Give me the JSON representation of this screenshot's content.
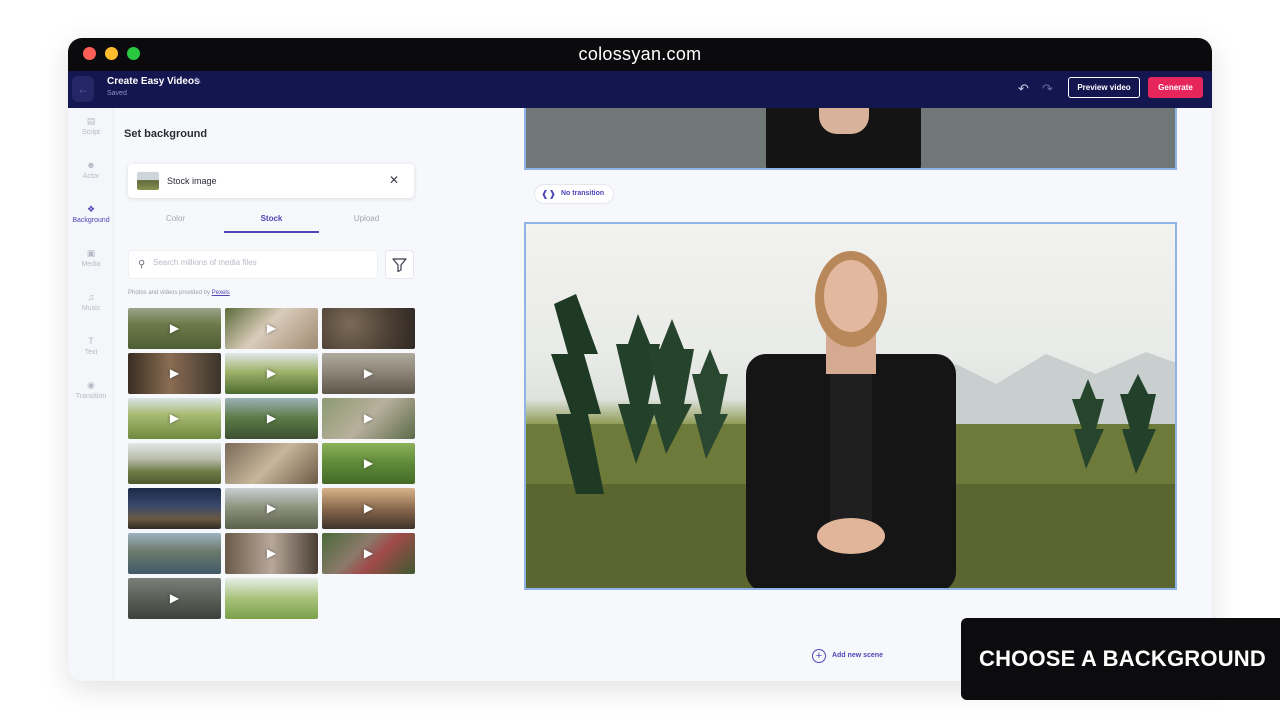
{
  "window": {
    "url": "colossyan.com"
  },
  "header": {
    "project_title": "Create Easy Videos",
    "status": "Saved",
    "preview_label": "Preview video",
    "generate_label": "Generate"
  },
  "rail": {
    "items": [
      {
        "label": "Script",
        "icon": "script-icon"
      },
      {
        "label": "Actor",
        "icon": "actor-icon"
      },
      {
        "label": "Background",
        "icon": "background-icon",
        "active": true
      },
      {
        "label": "Media",
        "icon": "media-icon"
      },
      {
        "label": "Music",
        "icon": "music-icon"
      },
      {
        "label": "Text",
        "icon": "text-icon"
      },
      {
        "label": "Transition",
        "icon": "transition-icon"
      }
    ]
  },
  "panel": {
    "title": "Set background",
    "selected": {
      "label": "Stock image"
    },
    "tabs": [
      "Color",
      "Stock",
      "Upload"
    ],
    "active_tab": "Stock",
    "search": {
      "placeholder": "Search millions of media files",
      "value": ""
    },
    "credit_prefix": "Photos and videos provided by",
    "credit_link": "Pexels"
  },
  "canvas": {
    "transition_label": "No transition",
    "add_scene_label": "Add new scene"
  },
  "overlay": {
    "caption": "CHOOSE A BACKGROUND"
  },
  "colors": {
    "accent": "#4f46b8",
    "generate": "#e6265b",
    "appbar": "#141650"
  }
}
